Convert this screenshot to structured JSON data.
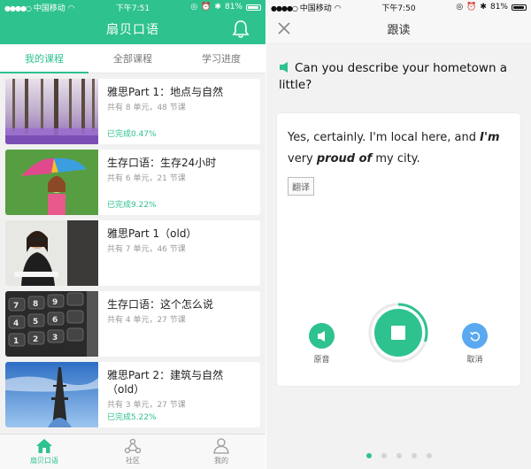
{
  "left_screen": {
    "status": {
      "carrier": "中国移动",
      "time": "下午7:51",
      "battery": "81%"
    },
    "header": {
      "title": "扇贝口语"
    },
    "tabs": [
      {
        "label": "我的课程",
        "active": true
      },
      {
        "label": "全部课程",
        "active": false
      },
      {
        "label": "学习进度",
        "active": false
      }
    ],
    "courses": [
      {
        "title": "雅思Part 1：地点与自然",
        "meta": "共有 8 单元，48 节课",
        "progress": "已完成0.47%",
        "thumb_icon": "forest-lavender-photo"
      },
      {
        "title": "生存口语：生存24小时",
        "meta": "共有 6 单元，21 节课",
        "progress": "已完成9.22%",
        "thumb_icon": "girl-umbrella-photo"
      },
      {
        "title": "雅思Part 1（old）",
        "meta": "共有 7 单元，46 节课",
        "progress": "",
        "thumb_icon": "interview-photo"
      },
      {
        "title": "生存口语：这个怎么说",
        "meta": "共有 4 单元，27 节课",
        "progress": "",
        "thumb_icon": "calculator-keys-photo"
      },
      {
        "title": "雅思Part 2：建筑与自然（old）",
        "meta": "共有 3 单元，27 节课",
        "progress": "已完成5.22%",
        "thumb_icon": "eiffel-tower-photo"
      }
    ],
    "bottom_nav": [
      {
        "label": "扇贝口语",
        "icon": "home-icon",
        "active": true
      },
      {
        "label": "社区",
        "icon": "community-icon",
        "active": false
      },
      {
        "label": "我的",
        "icon": "profile-icon",
        "active": false
      }
    ],
    "accent": "#2ec28e"
  },
  "right_screen": {
    "status": {
      "carrier": "中国移动",
      "time": "下午7:50",
      "battery": "81%"
    },
    "header": {
      "title": "跟读"
    },
    "question": "Can you describe your hometown a little?",
    "answer": {
      "part1": "Yes, certainly. I'm local here, and ",
      "em1": "I'm",
      "part2": " very ",
      "em2": "proud of",
      "part3": " my city."
    },
    "translate_label": "翻译",
    "controls": {
      "original_label": "原音",
      "cancel_label": "取消"
    },
    "record_progress": 0.3,
    "pager": {
      "count": 5,
      "active": 0
    }
  }
}
